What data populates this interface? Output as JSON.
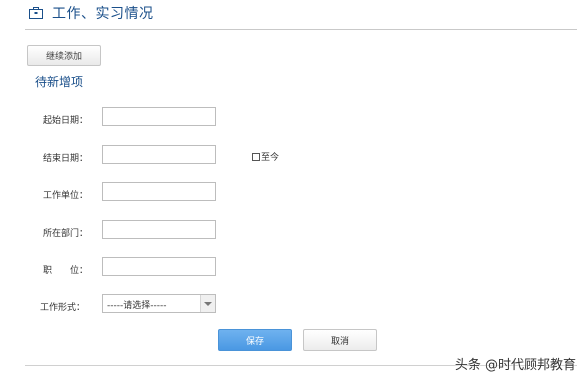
{
  "header": {
    "icon": "briefcase-icon",
    "title": "工作、实习情况"
  },
  "actions": {
    "add_label": "继续添加"
  },
  "section": {
    "title": "待新增项"
  },
  "form": {
    "start_date": {
      "label": "起始日期：",
      "value": ""
    },
    "end_date": {
      "label": "结束日期：",
      "value": ""
    },
    "until_now": {
      "label": "至今",
      "checked": false
    },
    "employer": {
      "label": "工作单位：",
      "value": ""
    },
    "department": {
      "label": "所在部门：",
      "value": ""
    },
    "position": {
      "label": "职　　位：",
      "value": ""
    },
    "work_type": {
      "label": "工作形式：",
      "selected": "-----请选择-----"
    }
  },
  "buttons": {
    "save": "保存",
    "cancel": "取消"
  },
  "watermark": {
    "text": "头条 @时代顾邦教育"
  },
  "colors": {
    "accent": "#4a98e3",
    "title": "#1a4f8a"
  }
}
